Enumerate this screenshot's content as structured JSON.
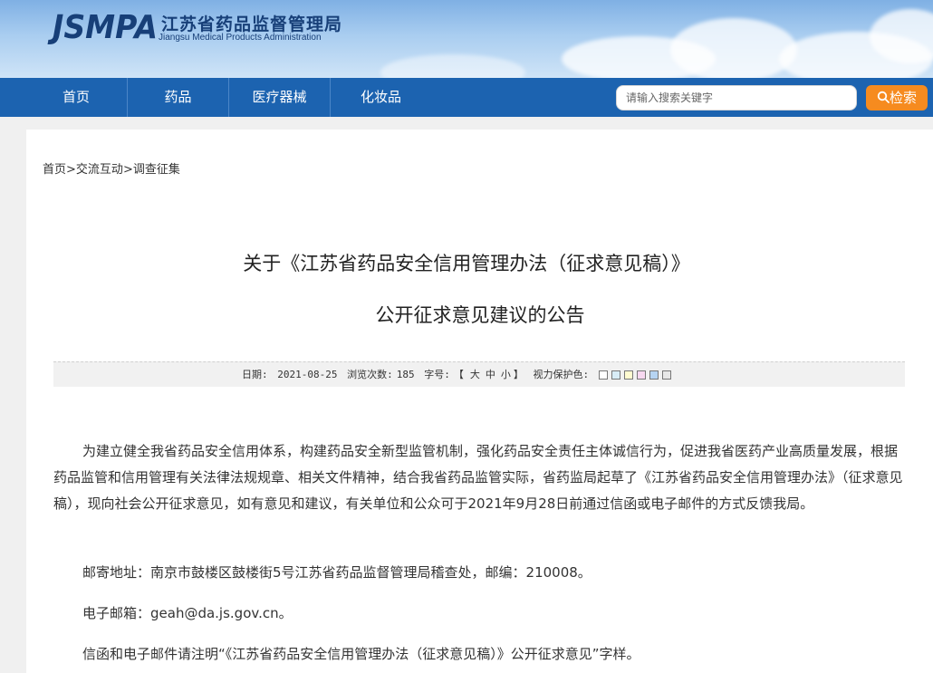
{
  "header": {
    "logo_mark": "JSMPA",
    "org_cn": "江苏省药品监督管理局",
    "org_en": "Jiangsu Medical Products Administration"
  },
  "nav": {
    "items": [
      "首页",
      "药品",
      "医疗器械",
      "化妆品"
    ],
    "search_placeholder": "请输入搜索关键字",
    "search_button": "检索"
  },
  "breadcrumb": {
    "items": [
      "首页",
      "交流互动",
      "调查征集"
    ],
    "separator": ">"
  },
  "article": {
    "title_line1": "关于《江苏省药品安全信用管理办法（征求意见稿）》",
    "title_line2": "公开征求意见建议的公告",
    "meta": {
      "date_label": "日期:",
      "date": "2021-08-25",
      "views_label": "浏览次数:",
      "views": "185",
      "font_label": "字号:",
      "font_open": "【",
      "font_large": "大",
      "font_medium": "中",
      "font_small": "小",
      "font_close": "】",
      "eye_label": "视力保护色:",
      "eye_colors": [
        "#ffffff",
        "#d8ecf6",
        "#fffbd0",
        "#f7d8f0",
        "#b6d4f2",
        "#e8e8e8"
      ]
    },
    "paragraph1": "为建立健全我省药品安全信用体系，构建药品安全新型监管机制，强化药品安全责任主体诚信行为，促进我省医药产业高质量发展，根据药品监管和信用管理有关法律法规规章、相关文件精神，结合我省药品监管实际，省药监局起草了《江苏省药品安全信用管理办法》（征求意见稿），现向社会公开征求意见，如有意见和建议，有关单位和公众可于2021年9月28日前通过信函或电子邮件的方式反馈我局。",
    "mail_address": "邮寄地址：南京市鼓楼区鼓楼街5号江苏省药品监督管理局稽查处，邮编：210008。",
    "email": "电子邮箱：geah@da.js.gov.cn。",
    "note": "信函和电子邮件请注明“《江苏省药品安全信用管理办法（征求意见稿）》公开征求意见”字样。"
  }
}
